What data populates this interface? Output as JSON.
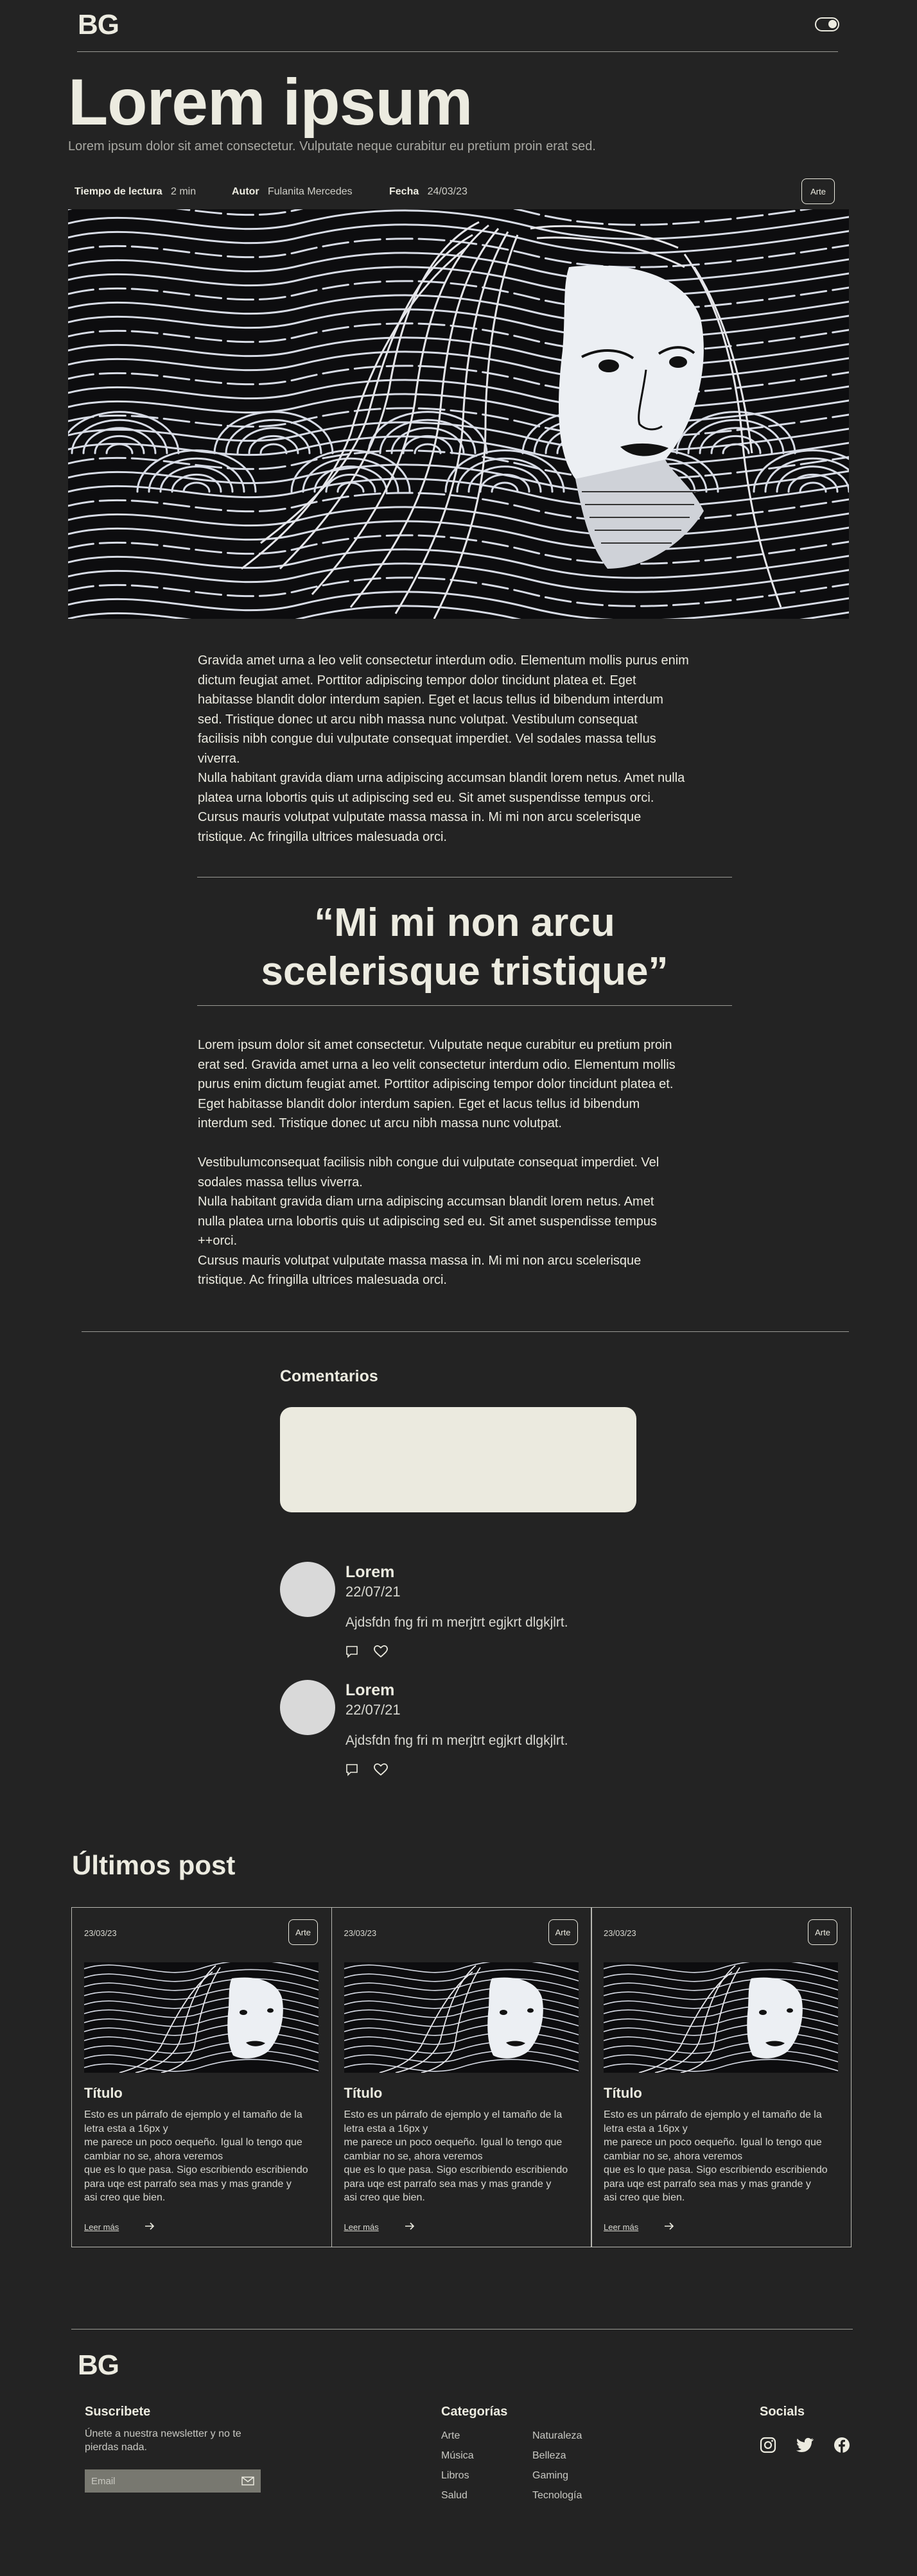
{
  "header": {
    "logo": "BG"
  },
  "hero": {
    "title": "Lorem ipsum",
    "subtitle": "Lorem ipsum dolor sit amet consectetur. Vulputate neque curabitur eu pretium proin erat sed."
  },
  "meta": {
    "reading_label": "Tiempo de lectura",
    "reading_value": "2 min",
    "author_label": "Autor",
    "author_value": "Fulanita Mercedes",
    "date_label": "Fecha",
    "date_value": "24/03/23",
    "tag": "Arte"
  },
  "article": {
    "p1": "Gravida amet urna a leo velit consectetur interdum odio. Elementum mollis purus enim\ndictum feugiat amet. Porttitor adipiscing tempor dolor tincidunt platea et. Eget\nhabitasse blandit dolor interdum sapien. Eget et lacus tellus id bibendum interdum\n sed. Tristique donec ut arcu nibh massa nunc volutpat. Vestibulum consequat\n facilisis nibh congue dui vulputate consequat imperdiet. Vel sodales massa tellus\nviverra.\nNulla habitant gravida diam urna adipiscing accumsan blandit lorem netus. Amet nulla\nplatea urna lobortis quis ut adipiscing sed eu. Sit amet suspendisse tempus orci.\n Cursus mauris volutpat vulputate massa massa in. Mi mi non arcu scelerisque\ntristique. Ac fringilla ultrices malesuada orci.",
    "quote_line1": "“Mi mi non arcu",
    "quote_line2": "scelerisque tristique”",
    "p2": "Lorem ipsum dolor sit amet consectetur. Vulputate neque curabitur eu pretium proin\nerat sed. Gravida amet urna a leo velit consectetur interdum odio. Elementum mollis\npurus enim dictum feugiat amet. Porttitor adipiscing tempor dolor tincidunt platea et.\nEget habitasse blandit dolor interdum sapien. Eget et lacus tellus id bibendum\ninterdum sed. Tristique donec ut arcu nibh massa nunc volutpat.\n\nVestibulumconsequat facilisis nibh congue dui vulputate consequat imperdiet. Vel\nsodales massa tellus viverra.\nNulla habitant gravida diam urna adipiscing accumsan blandit lorem netus. Amet\nnulla platea urna lobortis quis ut adipiscing sed eu. Sit amet suspendisse tempus\n++orci.\nCursus mauris volutpat vulputate massa massa in. Mi mi non arcu scelerisque\ntristique. Ac fringilla ultrices malesuada orci."
  },
  "comments": {
    "title": "Comentarios",
    "items": [
      {
        "name": "Lorem",
        "date": "22/07/21",
        "text": "Ajdsfdn fng fri m merjtrt egjkrt dlgkjlrt."
      },
      {
        "name": "Lorem",
        "date": "22/07/21",
        "text": "Ajdsfdn fng fri m merjtrt egjkrt dlgkjlrt."
      }
    ]
  },
  "latest": {
    "title": "Últimos post",
    "cards": [
      {
        "date": "23/03/23",
        "tag": "Arte",
        "title": "Título",
        "text": "Esto es un párrafo de ejemplo y el tamaño de la\nletra esta a 16px y\nme parece un poco oequeño. Igual lo tengo que\ncambiar no se, ahora veremos\nque es lo que pasa. Sigo escribiendo escribiendo\npara uqe est parrafo sea mas y mas grande y\nasi creo que bien.",
        "link": "Leer más"
      },
      {
        "date": "23/03/23",
        "tag": "Arte",
        "title": "Título",
        "text": "Esto es un párrafo de ejemplo y el tamaño de la\nletra esta a 16px y\nme parece un poco oequeño. Igual lo tengo que\ncambiar no se, ahora veremos\nque es lo que pasa. Sigo escribiendo escribiendo\npara uqe est parrafo sea mas y mas grande y\nasi creo que bien.",
        "link": "Leer más"
      },
      {
        "date": "23/03/23",
        "tag": "Arte",
        "title": "Título",
        "text": "Esto es un párrafo de ejemplo y el tamaño de la\nletra esta a 16px y\nme parece un poco oequeño. Igual lo tengo que\ncambiar no se, ahora veremos\nque es lo que pasa. Sigo escribiendo escribiendo\npara uqe est parrafo sea mas y mas grande y\nasi creo que bien.",
        "link": "Leer más"
      }
    ]
  },
  "footer": {
    "logo": "BG",
    "subscribe_title": "Suscribete",
    "subscribe_text": "Únete a nuestra newsletter y no te\npierdas nada.",
    "email_placeholder": "Email",
    "categories_title": "Categorías",
    "categories_col1": [
      "Arte",
      "Música",
      "Libros",
      "Salud"
    ],
    "categories_col2": [
      "Naturaleza",
      "Belleza",
      "Gaming",
      "Tecnología"
    ],
    "socials_title": "Socials"
  },
  "icons": {
    "toggle": "toggle-icon",
    "comment": "comment-icon",
    "heart": "heart-icon",
    "arrow": "arrow-right-icon",
    "mail": "mail-icon",
    "instagram": "instagram-icon",
    "twitter": "twitter-icon",
    "facebook": "facebook-icon"
  }
}
